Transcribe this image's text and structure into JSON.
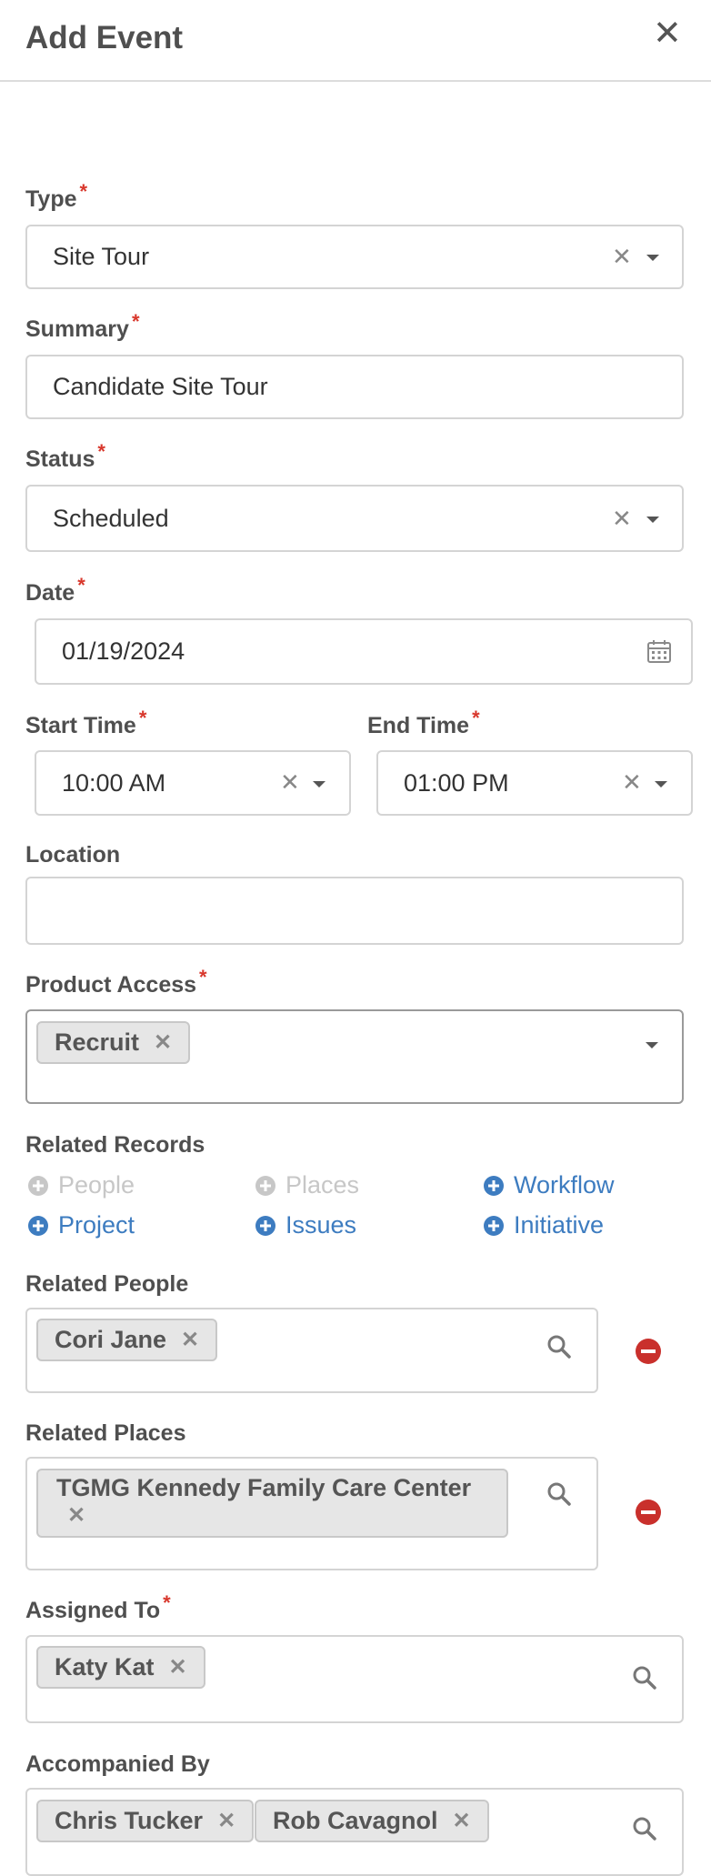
{
  "header": {
    "title": "Add Event",
    "close_glyph": "✕"
  },
  "required_mark": "*",
  "type": {
    "label": "Type",
    "value": "Site Tour"
  },
  "summary": {
    "label": "Summary",
    "value": "Candidate Site Tour"
  },
  "status": {
    "label": "Status",
    "value": "Scheduled"
  },
  "date": {
    "label": "Date",
    "value": "01/19/2024"
  },
  "start_time": {
    "label": "Start Time",
    "value": "10:00 AM"
  },
  "end_time": {
    "label": "End Time",
    "value": "01:00 PM"
  },
  "location": {
    "label": "Location",
    "value": ""
  },
  "product_access": {
    "label": "Product Access",
    "chips": [
      "Recruit"
    ]
  },
  "related_records": {
    "label": "Related Records",
    "links": [
      {
        "label": "People",
        "enabled": false
      },
      {
        "label": "Places",
        "enabled": false
      },
      {
        "label": "Workflow",
        "enabled": true
      },
      {
        "label": "Project",
        "enabled": true
      },
      {
        "label": "Issues",
        "enabled": true
      },
      {
        "label": "Initiative",
        "enabled": true
      }
    ]
  },
  "related_people": {
    "label": "Related People",
    "chips": [
      "Cori Jane"
    ]
  },
  "related_places": {
    "label": "Related Places",
    "chips": [
      "TGMG Kennedy Family Care Center"
    ]
  },
  "assigned_to": {
    "label": "Assigned To",
    "chips": [
      "Katy Kat"
    ]
  },
  "accompanied_by": {
    "label": "Accompanied By",
    "chips": [
      "Chris Tucker",
      "Rob Cavagnol"
    ]
  },
  "glyphs": {
    "clear": "✕",
    "chip_remove": "✕"
  },
  "icons": {
    "close": "close-icon",
    "clear": "clear-icon",
    "dropdown": "chevron-down-icon",
    "calendar": "calendar-icon",
    "search": "search-icon",
    "add": "plus-circle-icon",
    "remove": "minus-circle-icon"
  },
  "colors": {
    "link": "#3d7cc0",
    "required": "#d8372c",
    "remove": "#c9302c",
    "disabled": "#c7c7c7"
  }
}
